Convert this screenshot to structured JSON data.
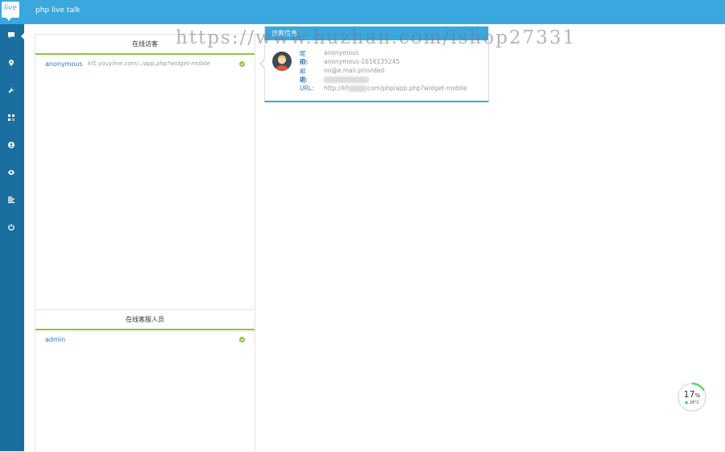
{
  "app": {
    "logo_text": "live",
    "title": "php live talk"
  },
  "sidebar": {
    "icons": [
      "chat-icon",
      "map-pin-icon",
      "wrench-icon",
      "qr-code-icon",
      "user-icon",
      "eye-icon",
      "list-icon",
      "power-icon"
    ]
  },
  "visitors_panel": {
    "title": "在线访客",
    "rows": [
      {
        "name": "anonymous",
        "url": "kf1.youyime.com/../app.php?widget-mobile"
      }
    ]
  },
  "staff_panel": {
    "title": "在线客服人员",
    "rows": [
      {
        "name": "admin"
      }
    ]
  },
  "visitor_info": {
    "title": "访客信息",
    "fields": [
      {
        "label": "昵称:",
        "value": "anonymous"
      },
      {
        "label": "ID:",
        "value": "anonymous-1616135245"
      },
      {
        "label": "邮箱:",
        "value": "no@e.mail.provided"
      },
      {
        "label": "IP:",
        "value": ""
      },
      {
        "label": "URL:",
        "value_prefix": "http://kf",
        "value_suffix": "com/php/app.php?widget-mobile"
      }
    ]
  },
  "watermark": "https://www.huzhan.com/ishop27331",
  "gauge": {
    "value": "17",
    "unit": "%",
    "temperature": "26°C",
    "percent": 17
  },
  "colors": {
    "topbar": "#3aa7de",
    "sidebar": "#1b6fa0",
    "online": "#8dc63f"
  }
}
